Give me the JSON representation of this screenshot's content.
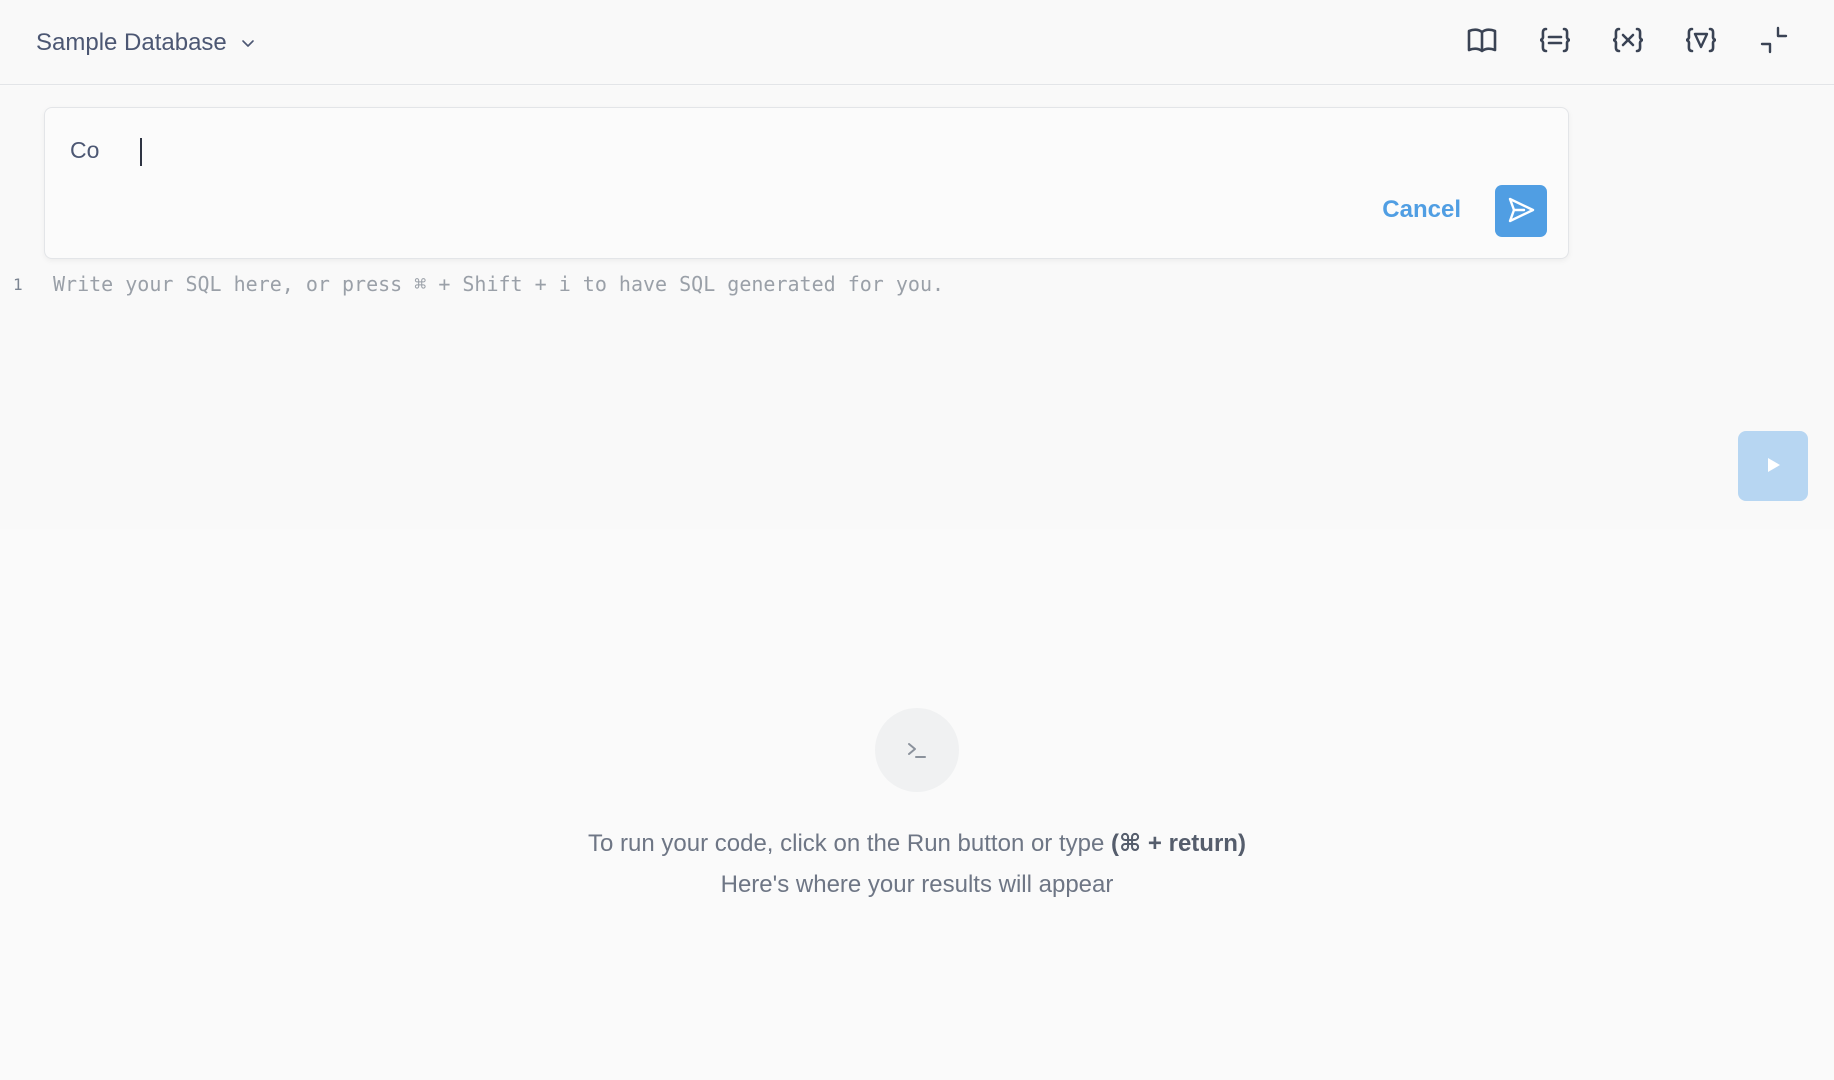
{
  "header": {
    "database_label": "Sample Database",
    "tools": [
      {
        "icon": "book-icon",
        "label": "Data reference"
      },
      {
        "icon": "snippets-icon",
        "label": "{=}"
      },
      {
        "icon": "variables-icon",
        "label": "{x}"
      },
      {
        "icon": "preview-query-icon",
        "label": "{}"
      },
      {
        "icon": "collapse-icon",
        "label": "Collapse editor"
      }
    ]
  },
  "ai_prompt": {
    "value": "Co",
    "cancel_label": "Cancel"
  },
  "editor": {
    "line_number": "1",
    "placeholder": "Write your SQL here, or press ⌘ + Shift + i to have SQL generated for you."
  },
  "results": {
    "message_line1_prefix": "To run your code, click on the Run button or type ",
    "message_line1_shortcut": "(⌘ + return)",
    "message_line2": "Here's where your results will appear"
  },
  "colors": {
    "accent": "#509ee3",
    "run_disabled": "#b7d6f2"
  }
}
